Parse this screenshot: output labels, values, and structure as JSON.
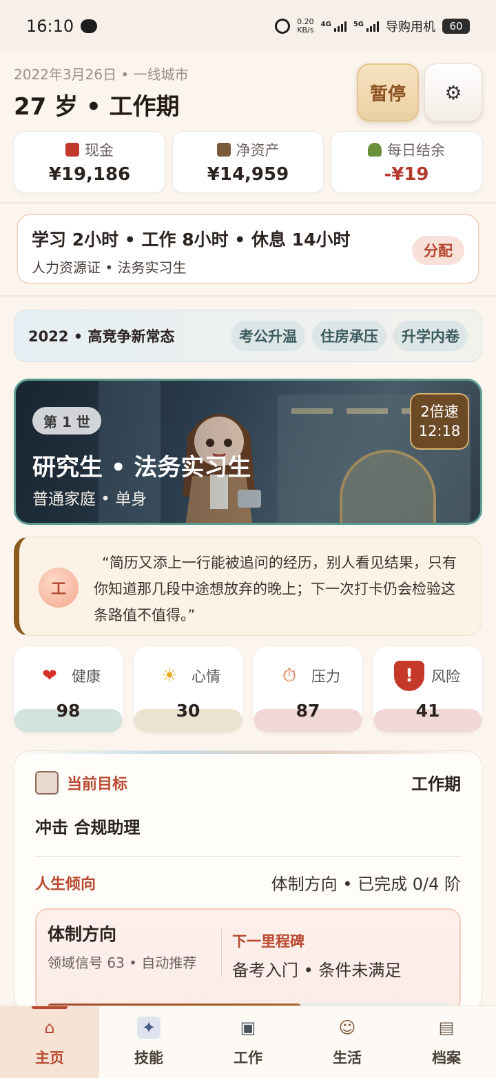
{
  "status_bar": {
    "time": "16:10",
    "net_speed_value": "0.20",
    "net_speed_unit": "KB/s",
    "signal1": "4G",
    "signal2": "5G",
    "carrier": "导购用机",
    "battery": "60"
  },
  "header": {
    "date_city": "2022年3月26日 • 一线城市",
    "age_stage": "27 岁 • 工作期",
    "pause_label": "暂停"
  },
  "stats": [
    {
      "label": "现金",
      "value": "¥19,186",
      "icon": "red-envelope-icon",
      "color": "#c0392b"
    },
    {
      "label": "净资产",
      "value": "¥14,959",
      "icon": "bank-icon",
      "color": "#7a5a3a"
    },
    {
      "label": "每日结余",
      "value": "-¥19",
      "icon": "sprout-icon",
      "color": "#6a8f3a"
    }
  ],
  "schedule": {
    "main": "学习 2小时 • 工作 8小时 • 休息 14小时",
    "sub": "人力资源证 • 法务实习生",
    "button": "分配"
  },
  "era": {
    "title": "2022 • 高竞争新常态",
    "tags": [
      "考公升温",
      "住房承压",
      "升学内卷"
    ]
  },
  "hero": {
    "life_badge": "第 1 世",
    "title": "研究生 • 法务实习生",
    "subtitle": "普通家庭 • 单身",
    "speed": "2倍速",
    "clock": "12:18"
  },
  "quote": {
    "avatar_char": "工",
    "text": "“简历又添上一行能被追问的经历，别人看见结果，只有你知道那几段中途想放弃的晚上；下一次打卡仍会检验这条路值不值得。”"
  },
  "metrics": [
    {
      "label": "健康",
      "value": "98",
      "icon": "heart-icon",
      "emoji": "❤",
      "bar_color": "#d3e2da"
    },
    {
      "label": "心情",
      "value": "30",
      "icon": "sun-icon",
      "emoji": "☀",
      "bar_color": "#ece2d0"
    },
    {
      "label": "压力",
      "value": "87",
      "icon": "stopwatch-icon",
      "emoji": "⏱",
      "bar_color": "#f0d8d6"
    },
    {
      "label": "风险",
      "value": "41",
      "icon": "shield-icon",
      "emoji": "!",
      "bar_color": "#f0d8d6"
    }
  ],
  "goal": {
    "label": "当前目标",
    "stage": "工作期",
    "target": "冲击 合规助理",
    "tendency_label": "人生倾向",
    "tendency_value": "体制方向 • 已完成 0/4 阶",
    "path_title": "体制方向",
    "path_sub": "领域信号 63 • 自动推荐",
    "next_label": "下一里程碑",
    "next_value": "备考入门 • 条件未满足",
    "progress": 0.63
  },
  "nav": [
    {
      "label": "主页",
      "icon": "home-icon",
      "glyph": "⌂",
      "active": true
    },
    {
      "label": "技能",
      "icon": "skill-book-icon",
      "glyph": "✦",
      "active": false
    },
    {
      "label": "工作",
      "icon": "briefcase-icon",
      "glyph": "▣",
      "active": false
    },
    {
      "label": "生活",
      "icon": "life-icon",
      "glyph": "☺",
      "active": false
    },
    {
      "label": "档案",
      "icon": "archive-icon",
      "glyph": "▤",
      "active": false
    }
  ]
}
